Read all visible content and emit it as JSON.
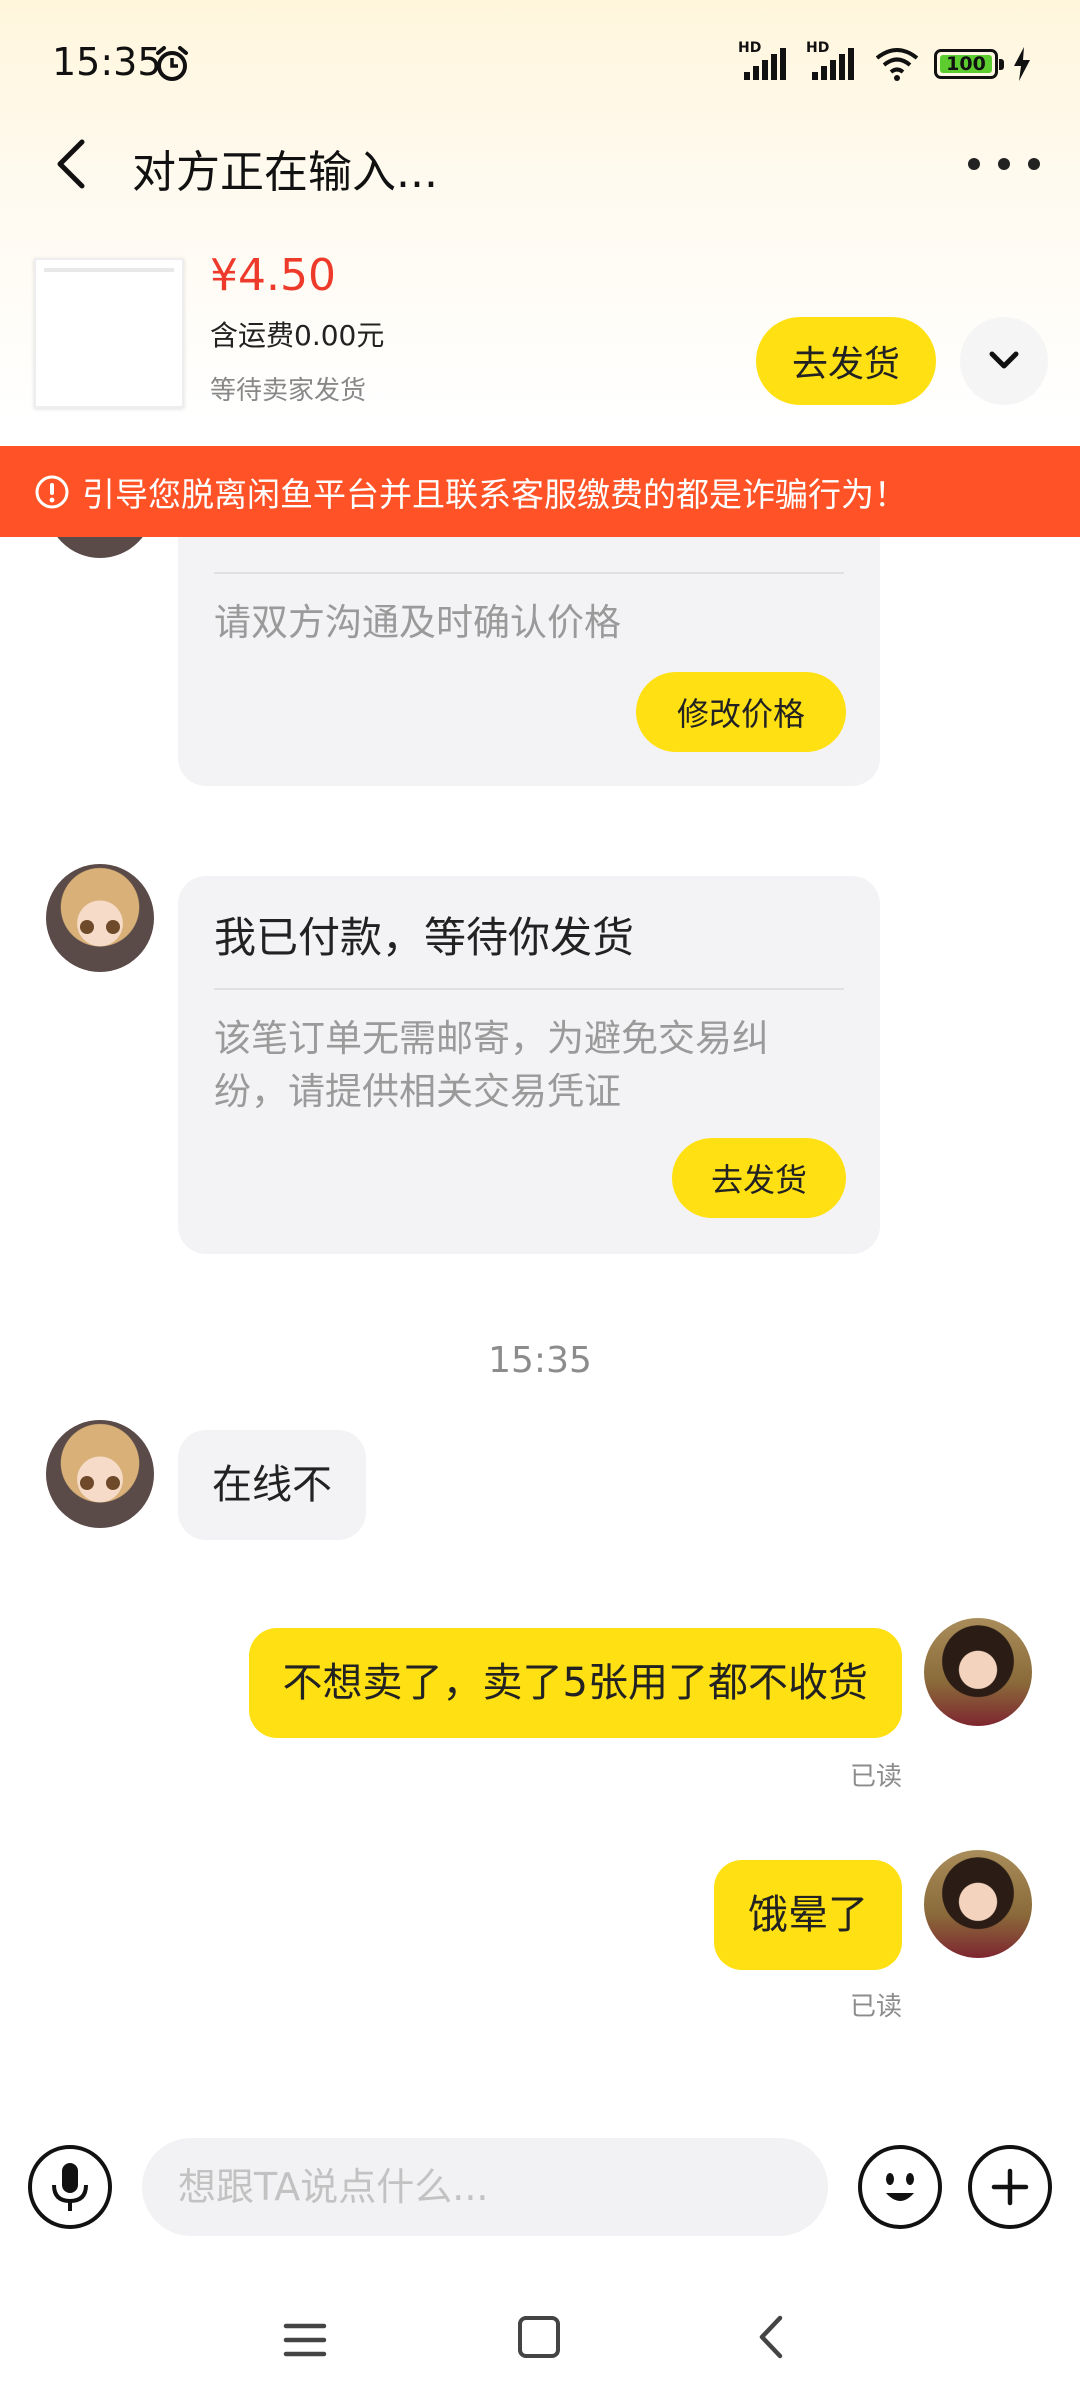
{
  "status_bar": {
    "time": "15:35",
    "battery": "100",
    "signal_label": "HD",
    "icons": [
      "alarm-icon",
      "signal-icon",
      "wifi-icon",
      "battery-icon",
      "charging-icon"
    ]
  },
  "header": {
    "title": "对方正在输入...",
    "icons": [
      "back-icon",
      "more-icon"
    ]
  },
  "product": {
    "price": "¥4.50",
    "shipping": "含运费0.00元",
    "status": "等待卖家发货",
    "ship_button": "去发货"
  },
  "warning": {
    "text": "引导您脱离闲鱼平台并且联系客服缴费的都是诈骗行为！",
    "color": "#ff5226"
  },
  "messages": {
    "card1": {
      "desc": "请双方沟通及时确认价格",
      "button": "修改价格"
    },
    "card2": {
      "title": "我已付款，等待你发货",
      "desc": "该笔订单无需邮寄，为避免交易纠纷，请提供相关交易凭证",
      "button": "去发货"
    },
    "time": "15:35",
    "incoming_text": "在线不",
    "outgoing1": {
      "text": "不想卖了，卖了5张用了都不收货",
      "status": "已读"
    },
    "outgoing2": {
      "text": "饿晕了",
      "status": "已读"
    }
  },
  "input": {
    "placeholder": "想跟TA说点什么...",
    "icons": [
      "microphone-icon",
      "emoji-icon",
      "plus-icon"
    ]
  },
  "accent_color": "#ffe113",
  "price_color": "#ee3a2a"
}
